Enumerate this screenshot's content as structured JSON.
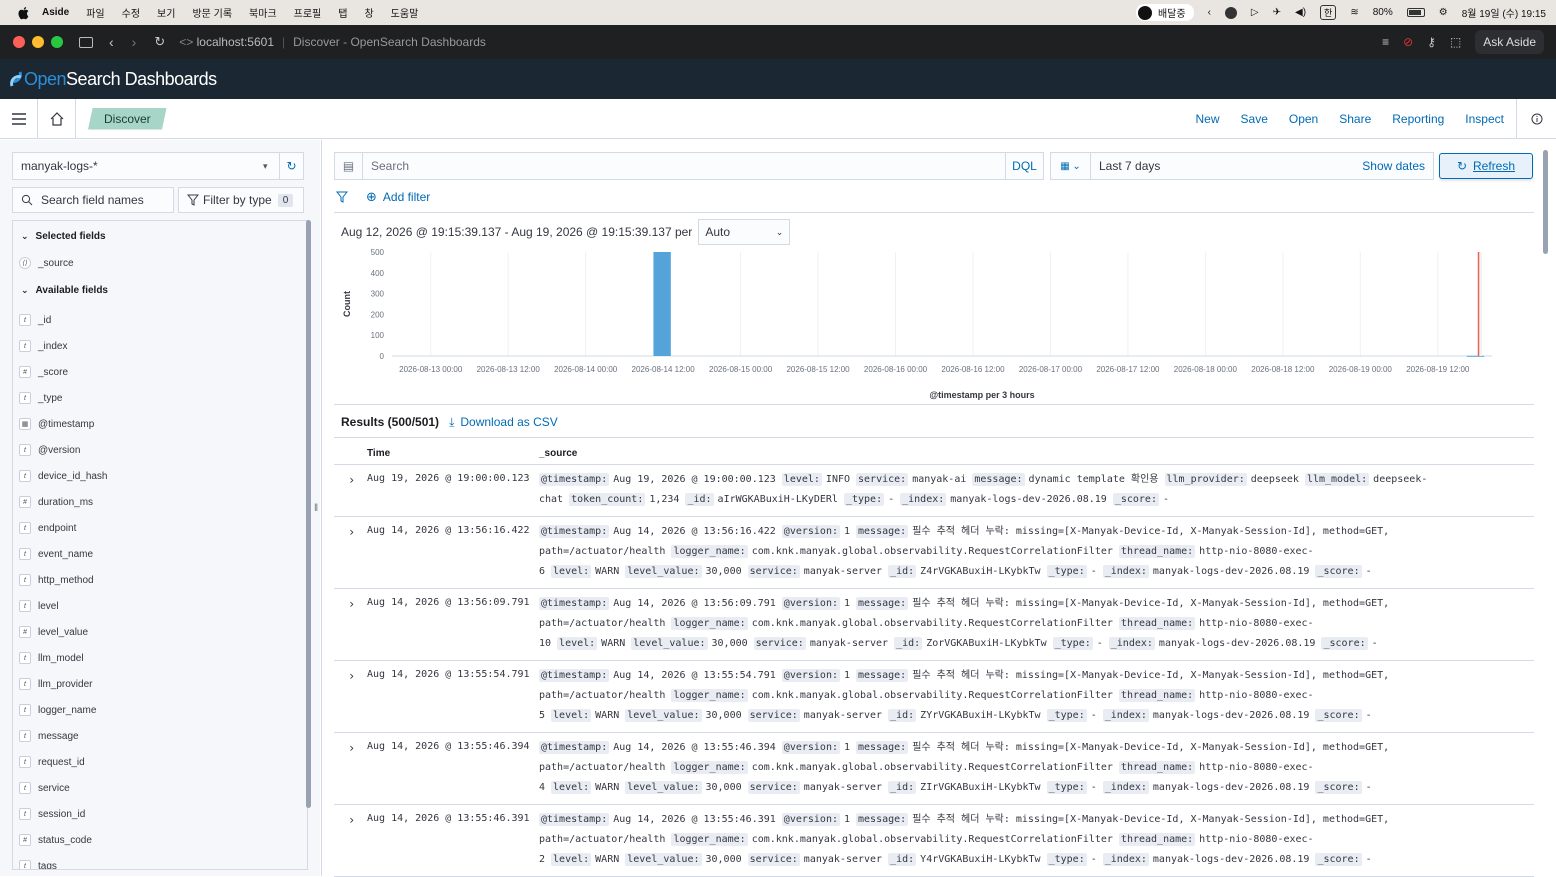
{
  "menubar": {
    "app_name": "Aside",
    "items": [
      "파일",
      "수정",
      "보기",
      "방문 기록",
      "북마크",
      "프로필",
      "탭",
      "창",
      "도움말"
    ],
    "status_text": "배달중",
    "battery": "80%",
    "datetime": "8월 19일 (수) 19:15"
  },
  "browser": {
    "url": "localhost:5601",
    "page_title": "Discover - OpenSearch Dashboards",
    "ask_label": "Ask Aside"
  },
  "osd": {
    "logo_open": "Open",
    "logo_rest": "Search Dashboards"
  },
  "nav": {
    "breadcrumb": "Discover",
    "links": [
      "New",
      "Save",
      "Open",
      "Share",
      "Reporting",
      "Inspect"
    ]
  },
  "sidebar": {
    "index_pattern": "manyak-logs-*",
    "search_placeholder": "Search field names",
    "filter_type_label": "Filter by type",
    "filter_count": "0",
    "selected_heading": "Selected fields",
    "available_heading": "Available fields",
    "selected_fields": [
      {
        "name": "_source",
        "type": "source"
      }
    ],
    "available_fields": [
      {
        "name": "_id",
        "type": "t"
      },
      {
        "name": "_index",
        "type": "t"
      },
      {
        "name": "_score",
        "type": "#"
      },
      {
        "name": "_type",
        "type": "t"
      },
      {
        "name": "@timestamp",
        "type": "date"
      },
      {
        "name": "@version",
        "type": "t"
      },
      {
        "name": "device_id_hash",
        "type": "t"
      },
      {
        "name": "duration_ms",
        "type": "#"
      },
      {
        "name": "endpoint",
        "type": "t"
      },
      {
        "name": "event_name",
        "type": "t"
      },
      {
        "name": "http_method",
        "type": "t"
      },
      {
        "name": "level",
        "type": "t"
      },
      {
        "name": "level_value",
        "type": "#"
      },
      {
        "name": "llm_model",
        "type": "t"
      },
      {
        "name": "llm_provider",
        "type": "t"
      },
      {
        "name": "logger_name",
        "type": "t"
      },
      {
        "name": "message",
        "type": "t"
      },
      {
        "name": "request_id",
        "type": "t"
      },
      {
        "name": "service",
        "type": "t"
      },
      {
        "name": "session_id",
        "type": "t"
      },
      {
        "name": "status_code",
        "type": "#"
      },
      {
        "name": "tags",
        "type": "t"
      }
    ]
  },
  "query": {
    "placeholder": "Search",
    "language": "DQL",
    "date_range": "Last 7 days",
    "show_dates": "Show dates",
    "refresh": "Refresh",
    "add_filter": "Add filter"
  },
  "histogram": {
    "interval_text": "Aug 12, 2026 @ 19:15:39.137 - Aug 19, 2026 @ 19:15:39.137 per",
    "interval_value": "Auto"
  },
  "chart_data": {
    "type": "bar",
    "xlabel": "@timestamp per 3 hours",
    "ylabel": "Count",
    "ylim": [
      0,
      500
    ],
    "yticks": [
      0,
      100,
      200,
      300,
      400,
      500
    ],
    "x_tick_labels": [
      "2026-08-13 00:00",
      "2026-08-13 12:00",
      "2026-08-14 00:00",
      "2026-08-14 12:00",
      "2026-08-15 00:00",
      "2026-08-15 12:00",
      "2026-08-16 00:00",
      "2026-08-16 12:00",
      "2026-08-17 00:00",
      "2026-08-17 12:00",
      "2026-08-18 00:00",
      "2026-08-18 12:00",
      "2026-08-19 00:00",
      "2026-08-19 12:00"
    ],
    "bars": [
      {
        "x": "2026-08-14 12:00",
        "value": 500
      },
      {
        "x": "2026-08-19 18:00",
        "value": 1
      }
    ],
    "bar_color": "#54a3d9",
    "now_marker_color": "#e7664c",
    "grid": true
  },
  "results": {
    "title": "Results (500/501)",
    "download": "Download as CSV",
    "col_time": "Time",
    "col_source": "_source",
    "rows": [
      {
        "time": "Aug 19, 2026 @ 19:00:00.123",
        "fields": [
          [
            "@timestamp:",
            "Aug 19, 2026 @ 19:00:00.123"
          ],
          [
            "level:",
            "INFO"
          ],
          [
            "service:",
            "manyak-ai"
          ],
          [
            "message:",
            "dynamic template 확인용"
          ],
          [
            "llm_provider:",
            "deepseek"
          ],
          [
            "llm_model:",
            "deepseek-chat"
          ],
          [
            "token_count:",
            "1,234"
          ],
          [
            "_id:",
            "aIrWGKABuxiH-LKyDERl"
          ],
          [
            "_type:",
            "-"
          ],
          [
            "_index:",
            "manyak-logs-dev-2026.08.19"
          ],
          [
            "_score:",
            "-"
          ]
        ]
      },
      {
        "time": "Aug 14, 2026 @ 13:56:16.422",
        "fields": [
          [
            "@timestamp:",
            "Aug 14, 2026 @ 13:56:16.422"
          ],
          [
            "@version:",
            "1"
          ],
          [
            "message:",
            "필수 추적 헤더 누락: missing=[X-Manyak-Device-Id, X-Manyak-Session-Id], method=GET, path=/actuator/health"
          ],
          [
            "logger_name:",
            "com.knk.manyak.global.observability.RequestCorrelationFilter"
          ],
          [
            "thread_name:",
            "http-nio-8080-exec-6"
          ],
          [
            "level:",
            "WARN"
          ],
          [
            "level_value:",
            "30,000"
          ],
          [
            "service:",
            "manyak-server"
          ],
          [
            "_id:",
            "Z4rVGKABuxiH-LKybkTw"
          ],
          [
            "_type:",
            "-"
          ],
          [
            "_index:",
            "manyak-logs-dev-2026.08.19"
          ],
          [
            "_score:",
            "-"
          ]
        ]
      },
      {
        "time": "Aug 14, 2026 @ 13:56:09.791",
        "fields": [
          [
            "@timestamp:",
            "Aug 14, 2026 @ 13:56:09.791"
          ],
          [
            "@version:",
            "1"
          ],
          [
            "message:",
            "필수 추적 헤더 누락: missing=[X-Manyak-Device-Id, X-Manyak-Session-Id], method=GET, path=/actuator/health"
          ],
          [
            "logger_name:",
            "com.knk.manyak.global.observability.RequestCorrelationFilter"
          ],
          [
            "thread_name:",
            "http-nio-8080-exec-10"
          ],
          [
            "level:",
            "WARN"
          ],
          [
            "level_value:",
            "30,000"
          ],
          [
            "service:",
            "manyak-server"
          ],
          [
            "_id:",
            "ZorVGKABuxiH-LKybkTw"
          ],
          [
            "_type:",
            "-"
          ],
          [
            "_index:",
            "manyak-logs-dev-2026.08.19"
          ],
          [
            "_score:",
            "-"
          ]
        ]
      },
      {
        "time": "Aug 14, 2026 @ 13:55:54.791",
        "fields": [
          [
            "@timestamp:",
            "Aug 14, 2026 @ 13:55:54.791"
          ],
          [
            "@version:",
            "1"
          ],
          [
            "message:",
            "필수 추적 헤더 누락: missing=[X-Manyak-Device-Id, X-Manyak-Session-Id], method=GET, path=/actuator/health"
          ],
          [
            "logger_name:",
            "com.knk.manyak.global.observability.RequestCorrelationFilter"
          ],
          [
            "thread_name:",
            "http-nio-8080-exec-5"
          ],
          [
            "level:",
            "WARN"
          ],
          [
            "level_value:",
            "30,000"
          ],
          [
            "service:",
            "manyak-server"
          ],
          [
            "_id:",
            "ZYrVGKABuxiH-LKybkTw"
          ],
          [
            "_type:",
            "-"
          ],
          [
            "_index:",
            "manyak-logs-dev-2026.08.19"
          ],
          [
            "_score:",
            "-"
          ]
        ]
      },
      {
        "time": "Aug 14, 2026 @ 13:55:46.394",
        "fields": [
          [
            "@timestamp:",
            "Aug 14, 2026 @ 13:55:46.394"
          ],
          [
            "@version:",
            "1"
          ],
          [
            "message:",
            "필수 추적 헤더 누락: missing=[X-Manyak-Device-Id, X-Manyak-Session-Id], method=GET, path=/actuator/health"
          ],
          [
            "logger_name:",
            "com.knk.manyak.global.observability.RequestCorrelationFilter"
          ],
          [
            "thread_name:",
            "http-nio-8080-exec-4"
          ],
          [
            "level:",
            "WARN"
          ],
          [
            "level_value:",
            "30,000"
          ],
          [
            "service:",
            "manyak-server"
          ],
          [
            "_id:",
            "ZIrVGKABuxiH-LKybkTw"
          ],
          [
            "_type:",
            "-"
          ],
          [
            "_index:",
            "manyak-logs-dev-2026.08.19"
          ],
          [
            "_score:",
            "-"
          ]
        ]
      },
      {
        "time": "Aug 14, 2026 @ 13:55:46.391",
        "fields": [
          [
            "@timestamp:",
            "Aug 14, 2026 @ 13:55:46.391"
          ],
          [
            "@version:",
            "1"
          ],
          [
            "message:",
            "필수 추적 헤더 누락: missing=[X-Manyak-Device-Id, X-Manyak-Session-Id], method=GET, path=/actuator/health"
          ],
          [
            "logger_name:",
            "com.knk.manyak.global.observability.RequestCorrelationFilter"
          ],
          [
            "thread_name:",
            "http-nio-8080-exec-2"
          ],
          [
            "level:",
            "WARN"
          ],
          [
            "level_value:",
            "30,000"
          ],
          [
            "service:",
            "manyak-server"
          ],
          [
            "_id:",
            "Y4rVGKABuxiH-LKybkTw"
          ],
          [
            "_type:",
            "-"
          ],
          [
            "_index:",
            "manyak-logs-dev-2026.08.19"
          ],
          [
            "_score:",
            "-"
          ]
        ]
      }
    ]
  }
}
